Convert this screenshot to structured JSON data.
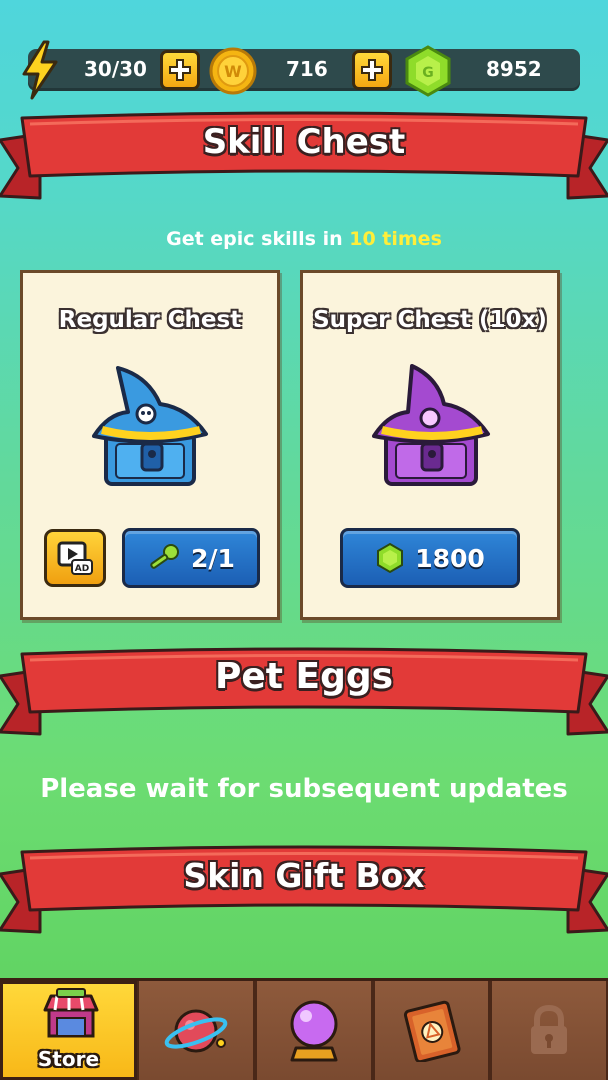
{
  "resources": {
    "energy": "30/30",
    "coins": "716",
    "gems": "8952"
  },
  "sections": {
    "skill_chest": "Skill Chest",
    "subtitle_prefix": "Get epic skills in ",
    "subtitle_highlight": "10 times",
    "pet_eggs": "Pet Eggs",
    "wait_message": "Please wait for subsequent updates",
    "skin_gift_box": "Skin Gift Box"
  },
  "chests": {
    "regular": {
      "title": "Regular Chest",
      "key_cost": "2/1",
      "ad_label": "AD"
    },
    "super": {
      "title": "Super Chest (10x)",
      "gem_cost": "1800"
    }
  },
  "nav": {
    "store_label": "Store",
    "tabs": [
      "store-icon",
      "planet-icon",
      "crystal-ball-icon",
      "spellbook-icon",
      "lock-icon"
    ]
  },
  "colors": {
    "ribbon_red": "#e23a38",
    "highlight_yellow": "#ffee3a",
    "button_blue": "#2a78cc",
    "nav_brown": "#7a4a30",
    "active_tab_yellow": "#ffd43a"
  }
}
